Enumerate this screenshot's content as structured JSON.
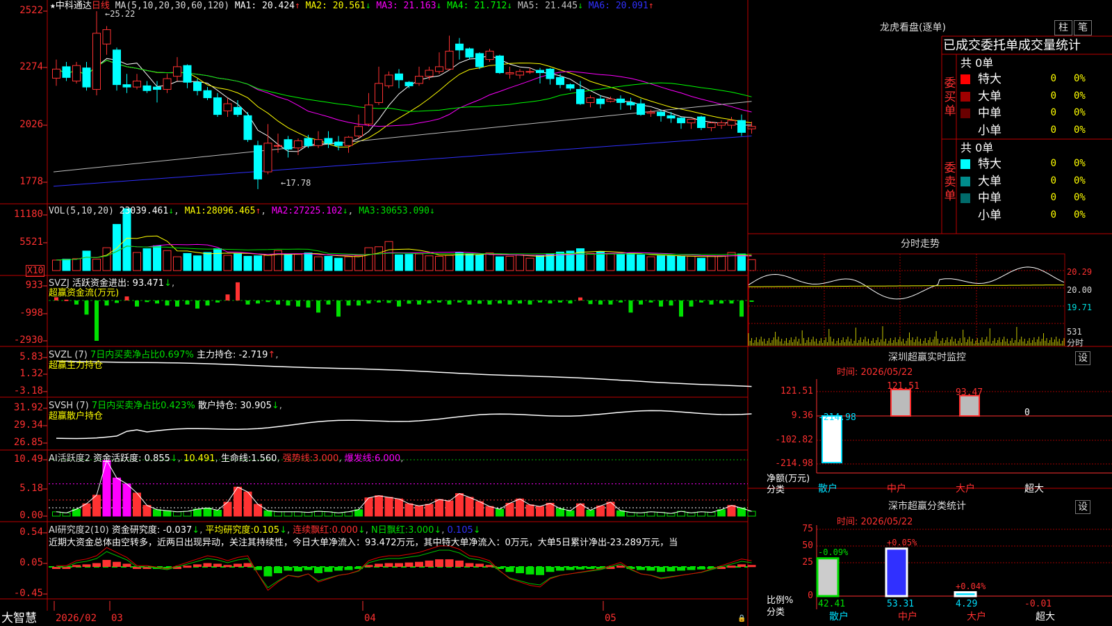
{
  "colors": {
    "up": "#ff3232",
    "down": "#00ffff",
    "green": "#00e000",
    "yellow": "#ffff00",
    "magenta": "#ff00ff",
    "blue": "#3030ff",
    "grid": "#a00000",
    "axis": "#ff3030",
    "white": "#ffffff"
  },
  "kline": {
    "star": "★",
    "stock_name": "中科通达",
    "period": "日线",
    "ma_params": "MA(5,10,20,30,60,120)",
    "ma": [
      {
        "label": "MA1:",
        "value": "20.424",
        "arrow": "↑",
        "color": "#ffffff"
      },
      {
        "label": "MA2:",
        "value": "20.561",
        "arrow": "↓",
        "color": "#ffff00"
      },
      {
        "label": "MA3:",
        "value": "21.163",
        "arrow": "↓",
        "color": "#ff00ff"
      },
      {
        "label": "MA4:",
        "value": "21.712",
        "arrow": "↓",
        "color": "#00ff00"
      },
      {
        "label": "MA5:",
        "value": "21.445",
        "arrow": "↓",
        "color": "#c0c0c0"
      },
      {
        "label": "MA6:",
        "value": "20.091",
        "arrow": "↑",
        "color": "#3030ff"
      }
    ],
    "y_ticks": [
      "2522",
      "2274",
      "2026",
      "1778"
    ],
    "high_label": "25.22",
    "low_label": "17.78",
    "candles": [
      [
        22.42,
        22.8,
        22.1,
        23.2
      ],
      [
        22.9,
        22.45,
        22.3,
        23.1
      ],
      [
        22.3,
        22.95,
        22.2,
        23.1
      ],
      [
        22.85,
        22.05,
        21.9,
        23.1
      ],
      [
        21.95,
        24.3,
        21.7,
        25.22
      ],
      [
        23.85,
        24.45,
        23.4,
        24.6
      ],
      [
        23.6,
        22.15,
        21.9,
        23.7
      ],
      [
        22.15,
        22.05,
        21.8,
        22.6
      ],
      [
        22.05,
        22.3,
        21.95,
        22.6
      ],
      [
        22.1,
        21.9,
        21.8,
        22.3
      ],
      [
        22.05,
        21.95,
        21.4,
        22.3
      ],
      [
        21.95,
        22.4,
        21.8,
        22.6
      ],
      [
        22.5,
        22.9,
        22.3,
        23.3
      ],
      [
        22.95,
        22.25,
        22.0,
        23.0
      ],
      [
        22.25,
        21.9,
        21.7,
        22.4
      ],
      [
        21.9,
        21.6,
        21.5,
        22.05
      ],
      [
        21.6,
        20.9,
        20.8,
        21.8
      ],
      [
        21.05,
        21.35,
        20.8,
        21.6
      ],
      [
        21.2,
        20.9,
        20.8,
        21.5
      ],
      [
        20.85,
        19.85,
        19.75,
        21.0
      ],
      [
        19.6,
        18.2,
        17.78,
        19.8
      ],
      [
        18.5,
        19.7,
        18.4,
        20.5
      ],
      [
        19.6,
        19.6,
        19.3,
        20.1
      ],
      [
        19.85,
        19.45,
        19.1,
        20.0
      ],
      [
        19.5,
        19.8,
        19.2,
        19.9
      ],
      [
        19.9,
        19.6,
        19.5,
        20.05
      ],
      [
        19.6,
        19.85,
        19.5,
        20.2
      ],
      [
        19.9,
        19.7,
        19.5,
        20.2
      ],
      [
        19.75,
        19.6,
        19.4,
        20.0
      ],
      [
        19.6,
        19.95,
        19.3,
        20.0
      ],
      [
        20.0,
        20.4,
        19.9,
        20.9
      ],
      [
        20.5,
        21.3,
        20.4,
        21.8
      ],
      [
        21.4,
        22.2,
        21.3,
        22.9
      ],
      [
        22.1,
        22.55,
        22.0,
        22.7
      ],
      [
        22.6,
        22.35,
        22.0,
        22.8
      ],
      [
        22.25,
        22.1,
        22.0,
        22.3
      ],
      [
        22.2,
        22.5,
        22.1,
        22.9
      ],
      [
        22.5,
        22.75,
        22.35,
        22.9
      ],
      [
        22.7,
        22.9,
        22.6,
        23.5
      ],
      [
        22.8,
        23.55,
        22.75,
        24.2
      ],
      [
        23.85,
        23.6,
        23.2,
        24.1
      ],
      [
        23.65,
        23.3,
        23.2,
        23.7
      ],
      [
        23.45,
        22.9,
        22.8,
        23.5
      ],
      [
        23.2,
        23.55,
        23.1,
        23.65
      ],
      [
        23.35,
        22.65,
        22.6,
        23.4
      ],
      [
        22.6,
        22.65,
        22.4,
        22.9
      ],
      [
        22.55,
        22.7,
        22.4,
        22.8
      ],
      [
        22.7,
        22.7,
        22.6,
        22.85
      ],
      [
        22.75,
        22.65,
        22.2,
        22.85
      ],
      [
        22.8,
        22.4,
        22.15,
        22.85
      ],
      [
        22.45,
        22.15,
        22.0,
        22.6
      ],
      [
        22.15,
        22.0,
        21.9,
        22.2
      ],
      [
        21.95,
        21.35,
        21.3,
        22.3
      ],
      [
        21.4,
        21.6,
        21.2,
        21.7
      ],
      [
        21.55,
        21.35,
        21.15,
        21.7
      ],
      [
        21.45,
        21.55,
        21.4,
        21.65
      ],
      [
        21.55,
        21.4,
        21.1,
        21.7
      ],
      [
        21.4,
        21.3,
        21.1,
        21.6
      ],
      [
        21.35,
        20.9,
        20.85,
        21.55
      ],
      [
        20.95,
        21.0,
        20.8,
        21.1
      ],
      [
        21.0,
        20.85,
        20.6,
        21.1
      ],
      [
        20.85,
        20.75,
        20.55,
        21.0
      ],
      [
        20.75,
        20.55,
        20.3,
        20.8
      ],
      [
        20.55,
        20.7,
        20.3,
        20.7
      ],
      [
        20.8,
        20.35,
        20.25,
        20.85
      ],
      [
        20.35,
        20.55,
        20.2,
        20.6
      ],
      [
        20.45,
        20.55,
        20.3,
        20.65
      ],
      [
        20.45,
        20.65,
        20.3,
        20.8
      ],
      [
        20.65,
        20.15,
        20.0,
        20.9
      ],
      [
        20.3,
        20.4,
        20.1,
        20.6
      ]
    ],
    "x_labels": [
      "2026/02",
      "03",
      "04",
      "05"
    ]
  },
  "vol": {
    "params": "VOL(5,10,20)",
    "value": "23039.461",
    "arrow": "↓",
    "ma1_label": "MA1:",
    "ma1": "28096.465",
    "ma1_arrow": "↑",
    "ma2_label": "MA2:",
    "ma2": "27225.102",
    "ma2_arrow": "↓",
    "ma3_label": "MA3:",
    "ma3": "30653.090",
    "ma3_arrow": "↓",
    "y_ticks": [
      "11180",
      "5521"
    ],
    "unit": "X10",
    "max": 13000,
    "values": [
      2200,
      2400,
      2500,
      4100,
      2400,
      4800,
      9700,
      13000,
      3800,
      4600,
      5200,
      4200,
      2900,
      3600,
      3100,
      3800,
      4600,
      3200,
      3500,
      3000,
      3100,
      3200,
      4200,
      3500,
      3400,
      3700,
      2900,
      3000,
      2600,
      2900,
      3100,
      4800,
      5000,
      6100,
      3300,
      3400,
      3500,
      3100,
      3000,
      3200,
      3800,
      3500,
      3300,
      3700,
      2900,
      3000,
      3300,
      2600,
      3200,
      3500,
      3900,
      4100,
      4600,
      3600,
      4000,
      3600,
      3400,
      3600,
      3300,
      2900,
      3100,
      3100,
      3000,
      3000,
      2600,
      3100,
      3100,
      3800,
      3500,
      2300
    ]
  },
  "svzj": {
    "name": "SVZJ",
    "label": "活跃资金进出:",
    "value": "93.471",
    "arrow": "↓",
    "sub": "超赢资金流(万元)",
    "y_ticks": [
      "933",
      "-998",
      "-2930"
    ],
    "values": [
      160,
      40,
      -200,
      -700,
      -2000,
      -250,
      -120,
      200,
      -300,
      -80,
      -150,
      -250,
      -300,
      -200,
      -400,
      -250,
      -100,
      300,
      900,
      -200,
      -150,
      -80,
      -200,
      -250,
      -300,
      -350,
      -600,
      -200,
      -800,
      -250,
      -250,
      -150,
      -100,
      -120,
      -300,
      -160,
      -200,
      -140,
      -100,
      -200,
      -100,
      -200,
      -160,
      -200,
      -150,
      -200,
      -150,
      -200,
      -100,
      -150,
      -100,
      -150,
      150,
      -180,
      -200,
      -200,
      -100,
      -600,
      -200,
      -100,
      -300,
      -250,
      -800,
      -300,
      -100,
      -200,
      -150,
      -150,
      -800,
      -50
    ]
  },
  "svzl": {
    "name": "SVZL (7)",
    "sub_left": "7日内买卖净占比0.697%",
    "label": "主力持仓:",
    "value": "-2.719",
    "arrow": "↑",
    "sub": "超赢主力持仓",
    "y_ticks": [
      "5.83",
      "1.32",
      "-3.18"
    ]
  },
  "svsh": {
    "name": "SVSH (7)",
    "sub_left": "7日内买卖净占比0.423%",
    "label": "散户持仓:",
    "value": "30.905",
    "arrow": "↓",
    "sub": "超赢散户持仓",
    "y_ticks": [
      "31.92",
      "29.34",
      "26.85"
    ]
  },
  "ai1": {
    "name": "AI活跃度2",
    "label": "资金活跃度:",
    "value": "0.855",
    "arrow": "↓",
    "v2": "10.491",
    "v3_label": "生命线:",
    "v3": "1.560",
    "v4_label": "强势线:",
    "v4": "3.000",
    "v5_label": "爆发线:",
    "v5": "6.000",
    "y_ticks": [
      "10.49",
      "5.18",
      "0.00"
    ],
    "values": [
      0.8,
      0.6,
      1.3,
      2.3,
      3.9,
      10.4,
      7.1,
      6.0,
      4.3,
      2.0,
      1.2,
      1.0,
      0.8,
      0.9,
      1.3,
      1.5,
      1.1,
      2.6,
      5.4,
      4.5,
      2.2,
      1.0,
      0.8,
      0.8,
      0.8,
      0.7,
      0.9,
      0.8,
      0.6,
      0.8,
      1.2,
      3.4,
      3.8,
      3.5,
      3.2,
      2.3,
      1.9,
      2.2,
      3.1,
      2.8,
      4.2,
      3.5,
      2.7,
      1.8,
      1.3,
      2.4,
      3.2,
      2.1,
      1.8,
      2.4,
      1.4,
      1.0,
      2.3,
      1.1,
      1.9,
      2.6,
      1.0,
      0.7,
      0.6,
      0.8,
      0.7,
      0.5,
      0.9,
      0.6,
      0.8,
      0.7,
      1.2,
      2.0,
      1.5,
      0.9
    ]
  },
  "ai2": {
    "name": "AI研究度2(10)",
    "label": "资金研究度:",
    "value": "-0.037",
    "arrow": "↓",
    "l2": "平均研究度:",
    "v2": "0.105",
    "a2": "↓",
    "l3": "连续飘红:",
    "v3": "0.000",
    "a3": "↓",
    "l4": "N日飘红:",
    "v4": "3.000",
    "a4": "↓",
    "v5": "0.105",
    "a5": "↓",
    "comment": "近期大资金总体由空转多，近两日出现异动，关注其持续性，今日大单净流入：93.472万元，其中特大单净流入：0万元，大单5日累计净出-23.289万元，当",
    "y_ticks": [
      "0.54",
      "0.05",
      "-0.45"
    ],
    "values": [
      0.0,
      0.0,
      0.03,
      0.04,
      0.06,
      0.11,
      0.08,
      0.05,
      0.0,
      0.0,
      -0.01,
      -0.02,
      0.0,
      0.02,
      0.04,
      0.06,
      0.05,
      0.03,
      0.05,
      0.06,
      -0.05,
      -0.15,
      -0.1,
      -0.06,
      -0.07,
      -0.05,
      -0.1,
      -0.08,
      -0.06,
      -0.05,
      -0.03,
      0.03,
      0.05,
      0.06,
      0.06,
      0.07,
      0.08,
      0.1,
      0.12,
      0.12,
      0.1,
      0.06,
      0.05,
      0.03,
      -0.03,
      -0.08,
      -0.1,
      -0.12,
      -0.13,
      -0.08,
      -0.06,
      -0.05,
      -0.04,
      -0.03,
      -0.02,
      0.0,
      0.02,
      -0.02,
      -0.05,
      -0.06,
      -0.08,
      -0.07,
      -0.06,
      -0.05,
      -0.04,
      -0.02,
      0.0,
      0.02,
      0.04,
      0.03
    ]
  },
  "right": {
    "lhb_title": "龙虎看盘(逐单)",
    "btn_zhu": "柱",
    "btn_bi": "笔",
    "order_header": "已成交委托单成交量统计",
    "buy_total": "共 0单",
    "sell_total": "共 0单",
    "buy_side": [
      "委",
      "买",
      "单"
    ],
    "sell_side": [
      "委",
      "卖",
      "单"
    ],
    "buy_rows": [
      {
        "name": "特大",
        "qty": "0",
        "pct": "0%",
        "color": "#ff0000"
      },
      {
        "name": "大单",
        "qty": "0",
        "pct": "0%",
        "color": "#a00000"
      },
      {
        "name": "中单",
        "qty": "0",
        "pct": "0%",
        "color": "#6a0000"
      },
      {
        "name": "小单",
        "qty": "0",
        "pct": "0%",
        "color": "#000000"
      }
    ],
    "sell_rows": [
      {
        "name": "特大",
        "qty": "0",
        "pct": "0%",
        "color": "#00ffff"
      },
      {
        "name": "大单",
        "qty": "0",
        "pct": "0%",
        "color": "#008c8c"
      },
      {
        "name": "中单",
        "qty": "0",
        "pct": "0%",
        "color": "#006a6a"
      },
      {
        "name": "小单",
        "qty": "0",
        "pct": "0%",
        "color": "#000000"
      }
    ],
    "fenshi_title": "分时走势",
    "fenshi_ticks": [
      "20.29",
      "20.00",
      "19.71",
      "531",
      "分时"
    ],
    "sz_title": "深圳超赢实时监控",
    "sz_btn": "设",
    "sz_time": "时间: 2026/05/22",
    "sz_y": [
      "121.51",
      "9.36",
      "-102.82",
      "-214.98"
    ],
    "sz_bars": [
      {
        "cat": "散户",
        "value": "-214.98"
      },
      {
        "cat": "中户",
        "value": "121.51"
      },
      {
        "cat": "大户",
        "value": "93.47"
      },
      {
        "cat": "超大",
        "value": "0"
      }
    ],
    "sz_ylabel": "净额(万元)",
    "sz_xlabel": "分类",
    "fl_title": "深市超赢分类统计",
    "fl_btn": "设",
    "fl_time": "时间: 2026/05/22",
    "fl_y": [
      "75",
      "50",
      "25",
      "0"
    ],
    "fl_bars": [
      {
        "cat": "散户",
        "pct": "42.41",
        "chg": "-0.09%"
      },
      {
        "cat": "中户",
        "pct": "53.31",
        "chg": "+0.05%"
      },
      {
        "cat": "大户",
        "pct": "4.29",
        "chg": "+0.04%"
      },
      {
        "cat": "超大",
        "pct": "-0.01",
        "chg": ""
      }
    ],
    "fl_ylabel": "比例%",
    "fl_xlabel": "分类"
  },
  "footer": {
    "brand": "大智慧"
  }
}
